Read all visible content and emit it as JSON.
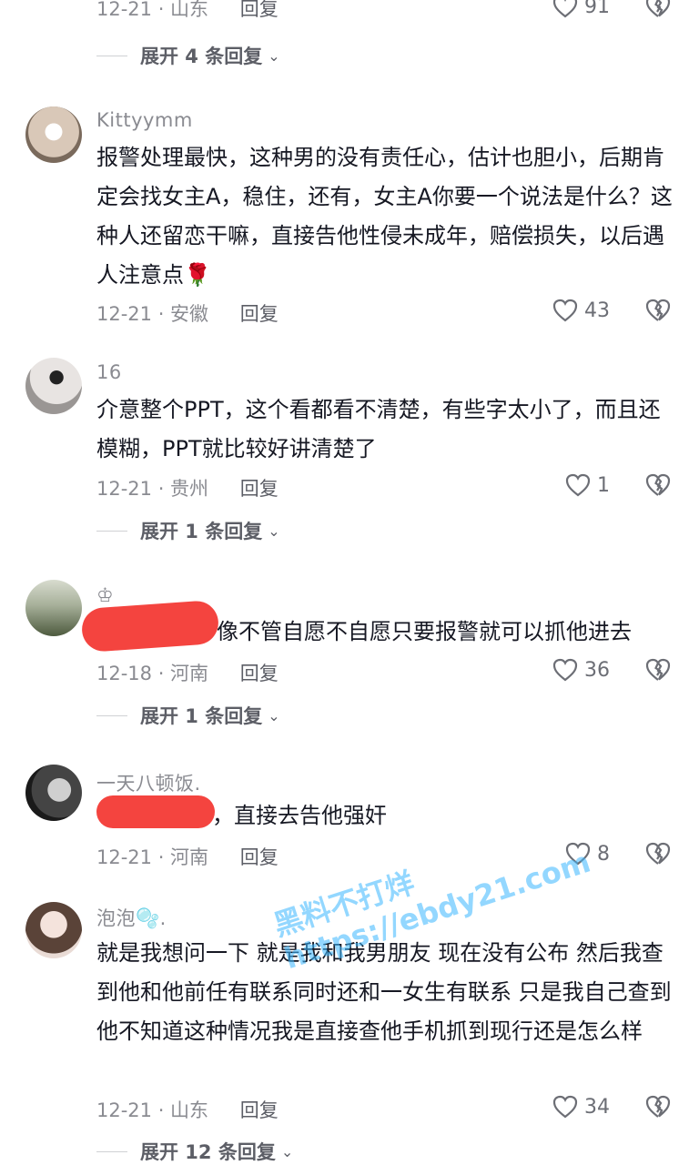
{
  "top": {
    "meta": "12-21 · 山东",
    "reply": "回复",
    "likes": "91",
    "expand": "展开 4 条回复"
  },
  "comments": [
    {
      "username": "Kittyymm",
      "text": "报警处理最快，这种男的没有责任心，估计也胆小，后期肯定会找女主A，稳住，还有，女主A你要一个说法是什么？这种人还留恋干嘛，直接告他性侵未成年，赔偿损失，以后遇人注意点🌹",
      "meta": "12-21 · 安徽",
      "reply": "回复",
      "likes": "43"
    },
    {
      "username": "16",
      "text": "介意整个PPT，这个看都看不清楚，有些字太小了，而且还模糊，PPT就比较好讲清楚了",
      "meta": "12-21 · 贵州",
      "reply": "回复",
      "likes": "1",
      "expand": "展开 1 条回复"
    },
    {
      "username": "♔",
      "text": "像不管自愿不自愿只要报警就可以抓他进去",
      "meta": "12-18 · 河南",
      "reply": "回复",
      "likes": "36",
      "expand": "展开 1 条回复"
    },
    {
      "username": "一天八顿饭.",
      "text": "，直接去告他强奸",
      "meta": "12-21 · 河南",
      "reply": "回复",
      "likes": "8"
    },
    {
      "username": "泡泡🫧.",
      "text": "就是我想问一下 就是我和我男朋友 现在没有公布 然后我查到他和他前任有联系同时还和一女生有联系 只是我自己查到 他不知道这种情况我是直接查他手机抓到现行还是怎么样",
      "meta": "12-21 · 山东",
      "reply": "回复",
      "likes": "34",
      "expand": "展开 12 条回复"
    }
  ],
  "watermark": "黑料不打烊 https://ebdy21.com",
  "colors": {
    "text": "#161823",
    "muted": "#8a8b91",
    "redaction": "#f4443f",
    "watermark": "#3cb8ff"
  },
  "icons": [
    "heart-icon",
    "broken-heart-icon",
    "chevron-down-icon"
  ]
}
